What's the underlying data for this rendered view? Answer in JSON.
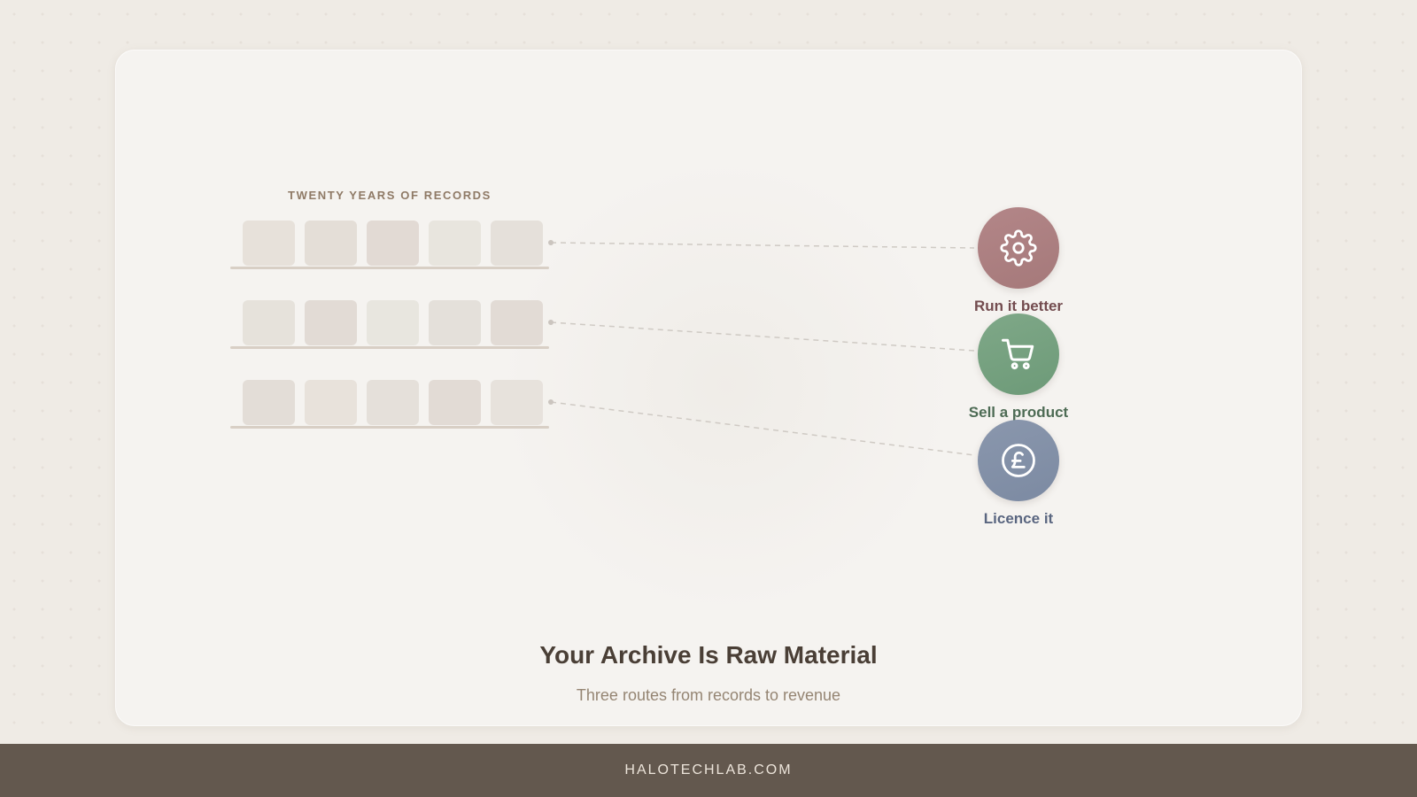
{
  "records_label": "TWENTY YEARS OF RECORDS",
  "shelves": [
    {
      "boxes": [
        "#e7e1da",
        "#e4ded7",
        "#e2dad4",
        "#e8e5de",
        "#e5e0da"
      ]
    },
    {
      "boxes": [
        "#e6e2db",
        "#e2dbd5",
        "#e8e6df",
        "#e4e0da",
        "#e2dbd5"
      ]
    },
    {
      "boxes": [
        "#e3ddd7",
        "#e8e2db",
        "#e5e0da",
        "#e2dbd5",
        "#e7e2dc"
      ]
    }
  ],
  "routes": [
    {
      "label": "Run it better",
      "icon": "gear-icon",
      "color": "#a5797a",
      "color_light": "#b38688",
      "label_color": "#734c4f"
    },
    {
      "label": "Sell a product",
      "icon": "cart-icon",
      "color": "#6d9a78",
      "color_light": "#7fa888",
      "label_color": "#4d6b54"
    },
    {
      "label": "Licence it",
      "icon": "pound-icon",
      "color": "#7c8aa2",
      "color_light": "#8a97ad",
      "label_color": "#5a6680"
    }
  ],
  "headline": "Your Archive Is Raw Material",
  "subheadline": "Three routes from records to revenue",
  "footer": "HALOTECHLAB.COM"
}
